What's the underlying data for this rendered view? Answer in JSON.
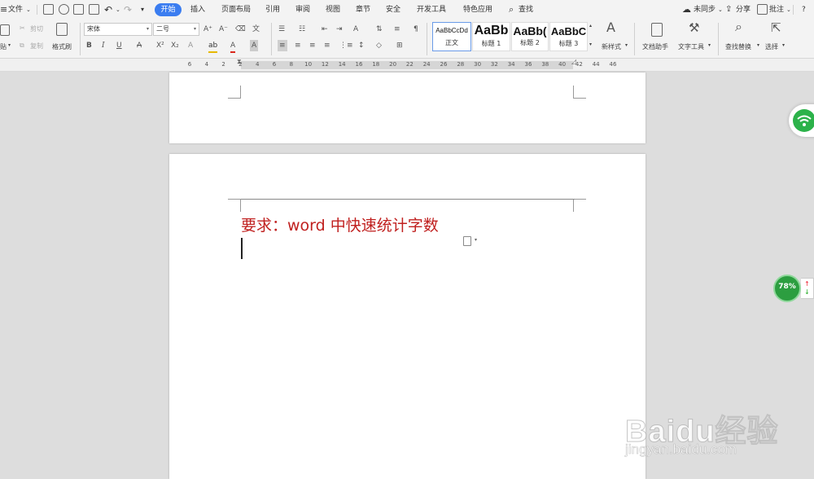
{
  "menu": {
    "file": "文件",
    "tabs": [
      "开始",
      "插入",
      "页面布局",
      "引用",
      "审阅",
      "视图",
      "章节",
      "安全",
      "开发工具",
      "特色应用"
    ],
    "active_tab": "开始",
    "search": "查找",
    "right": {
      "sync": "未同步",
      "share": "分享",
      "comment": "批注",
      "help": "?"
    }
  },
  "ribbon": {
    "clipboard": {
      "paste": "贴",
      "cut": "剪切",
      "copy": "复制",
      "format_painter": "格式刷"
    },
    "font_name": "宋体",
    "font_size": "二号",
    "styles": [
      {
        "preview": "AaBbCcDd",
        "label": "正文"
      },
      {
        "preview": "AaBb",
        "label": "标题 1"
      },
      {
        "preview": "AaBb(",
        "label": "标题 2"
      },
      {
        "preview": "AaBbC",
        "label": "标题 3"
      }
    ],
    "new_style": "新样式",
    "doc_helper": "文档助手",
    "text_tools": "文字工具",
    "find_replace": "查找替换",
    "select": "选择"
  },
  "ruler": {
    "ticks": [
      "6",
      "4",
      "2",
      "2",
      "4",
      "6",
      "8",
      "10",
      "12",
      "14",
      "16",
      "18",
      "20",
      "22",
      "24",
      "26",
      "28",
      "30",
      "32",
      "34",
      "36",
      "38",
      "40",
      "42",
      "44",
      "46"
    ]
  },
  "document": {
    "title_text": "要求：word 中快速统计字数"
  },
  "widgets": {
    "perf_percent": "78%"
  },
  "watermark": {
    "brand": "Baidu经验",
    "url": "jingyan.baidu.com"
  },
  "colors": {
    "accent": "#3b7df0",
    "title_red": "#c0201f",
    "green": "#2cb24a"
  }
}
